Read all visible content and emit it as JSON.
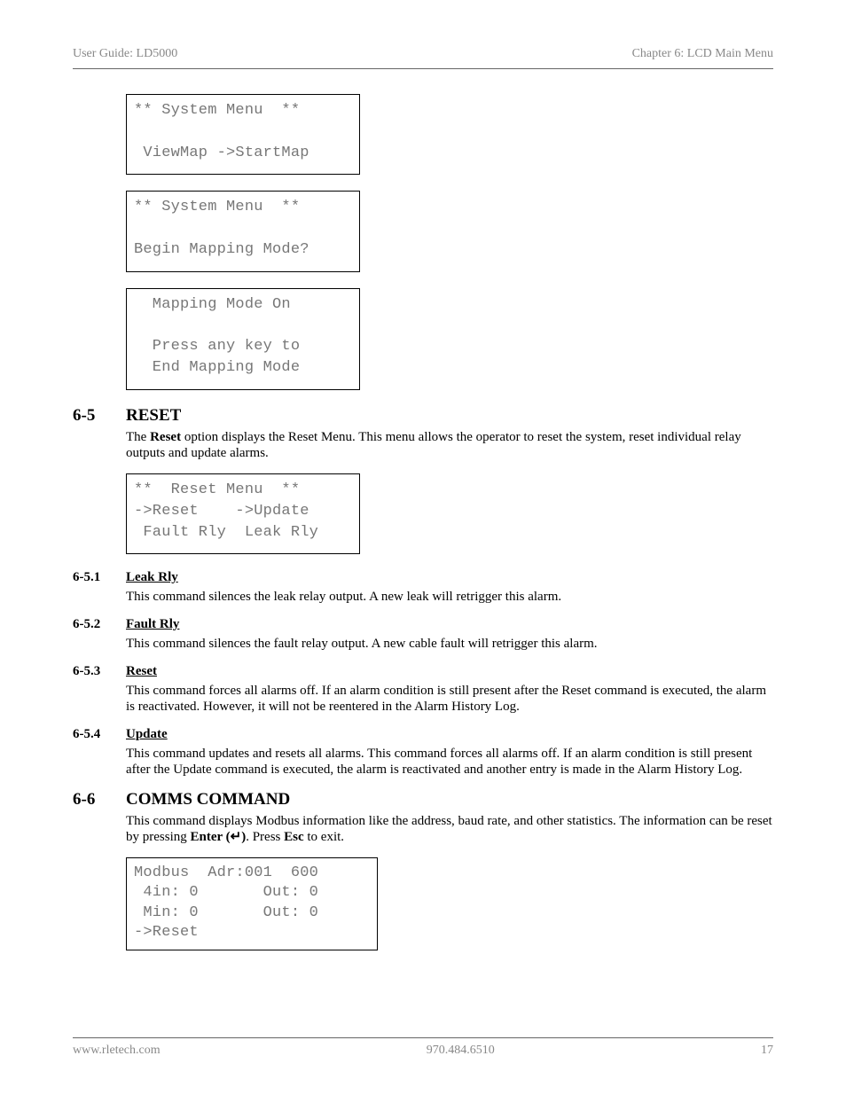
{
  "header": {
    "left": "User Guide: LD5000",
    "right": "Chapter 6: LCD Main Menu"
  },
  "lcd1": {
    "l1": "** System Menu  **",
    "l2": " ViewMap ->StartMap"
  },
  "lcd2": {
    "l1": "** System Menu  **",
    "l2": "Begin Mapping Mode?"
  },
  "lcd3": {
    "l1": "  Mapping Mode On",
    "l2": "  Press any key to",
    "l3": "  End Mapping Mode"
  },
  "s65": {
    "num": "6-5",
    "title": "RESET",
    "intro_pre": "The ",
    "intro_bold": "Reset",
    "intro_post": " option displays the Reset Menu.  This menu allows the operator to reset the system, reset individual relay outputs and update alarms."
  },
  "lcd4": {
    "l1": "**  Reset Menu  **",
    "l2": "->Reset    ->Update",
    "l3": " Fault Rly  Leak Rly"
  },
  "s651": {
    "num": "6-5.1",
    "title": "Leak Rly",
    "body": "This command silences the leak relay output.  A new leak will retrigger this alarm."
  },
  "s652": {
    "num": "6-5.2",
    "title": "Fault Rly",
    "body": "This command silences the fault relay output.  A new cable fault will retrigger this alarm."
  },
  "s653": {
    "num": "6-5.3",
    "title": "Reset",
    "body": "This command forces all alarms off.  If an alarm condition is still present after the Reset command is executed, the alarm is reactivated.  However, it will not be reentered in the Alarm History Log."
  },
  "s654": {
    "num": "6-5.4",
    "title": "Update",
    "body": "This command updates and resets all alarms.  This command forces all alarms off.  If an alarm condition is still present after the Update command is executed, the alarm is reactivated and another entry is made in the Alarm History Log."
  },
  "s66": {
    "num": "6-6",
    "title": "COMMS COMMAND",
    "body_pre": "This command displays Modbus information like the address, baud rate, and other statistics.  The information can be reset by pressing ",
    "enter": "Enter (↵)",
    "mid": ".  Press ",
    "esc": "Esc",
    "post": " to exit."
  },
  "lcd5": {
    "l1": "Modbus  Adr:001  600",
    "l2": " 4in: 0       Out: 0",
    "l3": " Min: 0       Out: 0",
    "l4": "->Reset"
  },
  "footer": {
    "left": "www.rletech.com",
    "mid": "970.484.6510",
    "right": "17"
  }
}
